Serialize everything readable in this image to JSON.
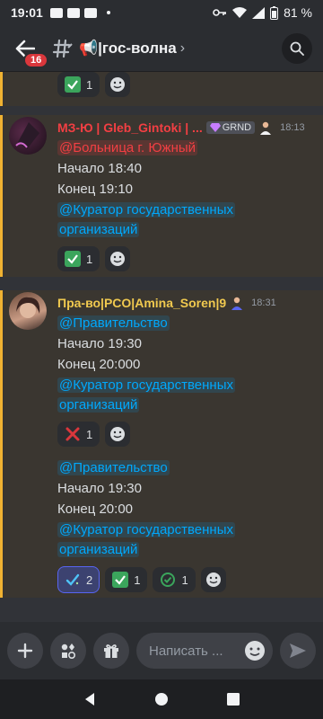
{
  "status": {
    "time": "19:01",
    "battery": "81 %"
  },
  "header": {
    "badge": "16",
    "channel_name": "📢|гос-волна",
    "chevron": "›"
  },
  "reaction_top": {
    "count": "1"
  },
  "msg1": {
    "username": "МЗ-Ю | Gleb_Gintoki | ...",
    "tag": "GRND",
    "time": "18:13",
    "mention": "@Больница г. Южный",
    "lines": [
      "Начало 18:40",
      "Конец 19:10"
    ],
    "mention2_a": "@Куратор государственных",
    "mention2_b": "организаций",
    "reaction_count": "1"
  },
  "msg2": {
    "username": "Пра-во|PCO|Amina_Soren|9",
    "time": "18:31",
    "mention": "@Правительство",
    "lines": [
      "Начало 19:30",
      "Конец 20:000"
    ],
    "mention2_a": "@Куратор государственных",
    "mention2_b": "организаций",
    "reaction_count": "1"
  },
  "msg3": {
    "mention": "@Правительство",
    "lines": [
      "Начало 19:30",
      "Конец 20:00"
    ],
    "mention2_a": "@Куратор государственных",
    "mention2_b": "организаций",
    "reactions": [
      "2",
      "1",
      "1"
    ]
  },
  "composer": {
    "placeholder": "Написать ..."
  },
  "colors": {
    "accent": "#5865f2",
    "highlight_bar": "#f0b232",
    "name_red": "#f23f43",
    "name_yellow": "#f0c94f",
    "check_green": "#3ba55c",
    "cross_red": "#da373c"
  }
}
